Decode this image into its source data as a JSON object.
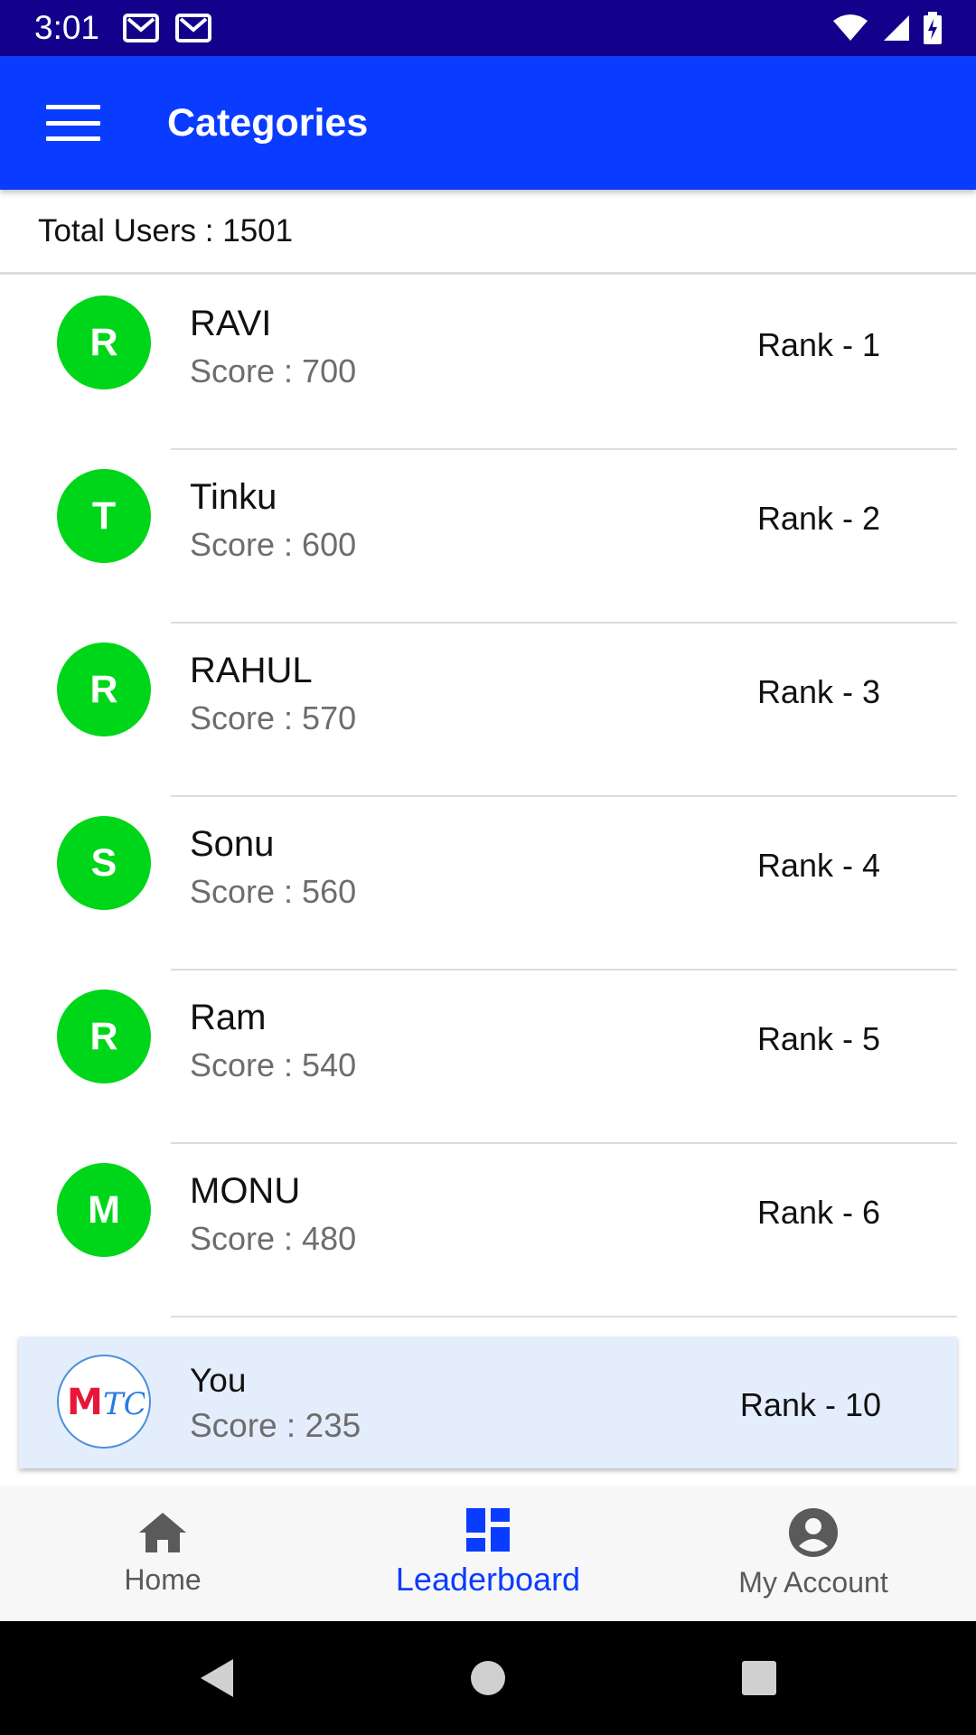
{
  "status_bar": {
    "time": "3:01"
  },
  "app_bar": {
    "title": "Categories"
  },
  "total_users": "Total Users : 1501",
  "leaderboard": [
    {
      "initial": "R",
      "name": "RAVI",
      "score": "Score : 700",
      "rank": "Rank - 1"
    },
    {
      "initial": "T",
      "name": "Tinku",
      "score": "Score : 600",
      "rank": "Rank - 2"
    },
    {
      "initial": "R",
      "name": "RAHUL",
      "score": "Score : 570",
      "rank": "Rank - 3"
    },
    {
      "initial": "S",
      "name": "Sonu",
      "score": "Score : 560",
      "rank": "Rank - 4"
    },
    {
      "initial": "R",
      "name": "Ram",
      "score": "Score : 540",
      "rank": "Rank - 5"
    },
    {
      "initial": "M",
      "name": "MONU",
      "score": "Score : 480",
      "rank": "Rank - 6"
    }
  ],
  "you": {
    "logo_text": "MTC",
    "name": "You",
    "score": "Score : 235",
    "rank": "Rank - 10"
  },
  "bottom_nav": [
    {
      "label": "Home",
      "icon": "home-icon"
    },
    {
      "label": "Leaderboard",
      "icon": "dashboard-icon",
      "active": true
    },
    {
      "label": "My Account",
      "icon": "account-circle-icon"
    }
  ],
  "system_nav": {
    "back": "back-icon",
    "home": "home-circle-icon",
    "recents": "recents-icon"
  },
  "colors": {
    "status_bar": "#14008a",
    "app_bar": "#0a3cff",
    "avatar": "#00d619",
    "you_card": "#e3edfb"
  }
}
